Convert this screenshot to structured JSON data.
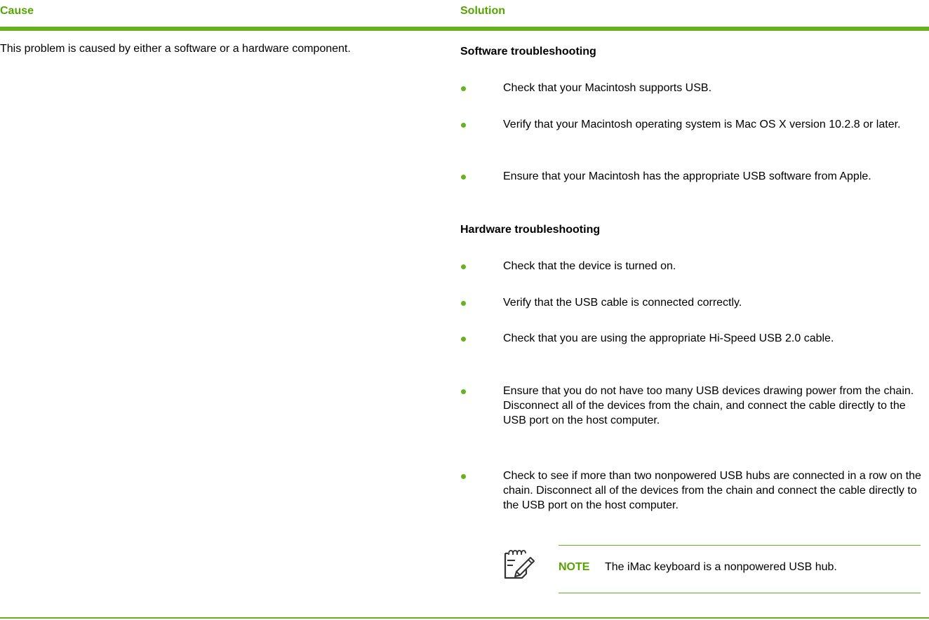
{
  "table": {
    "headers": {
      "cause": "Cause",
      "solution": "Solution"
    },
    "cause_text": "This problem is caused by either a software or a hardware component.",
    "software": {
      "heading": "Software troubleshooting",
      "items": [
        "Check that your Macintosh supports USB.",
        "Verify that your Macintosh operating system is Mac OS X version 10.2.8 or later.",
        "Ensure that your Macintosh has the appropriate USB software from Apple."
      ]
    },
    "hardware": {
      "heading": "Hardware troubleshooting",
      "items": [
        "Check that the device is turned on.",
        "Verify that the USB cable is connected correctly.",
        "Check that you are using the appropriate Hi-Speed USB 2.0 cable.",
        "Ensure that you do not have too many USB devices drawing power from the chain. Disconnect all of the devices from the chain, and connect the cable directly to the USB port on the host computer.",
        "Check to see if more than two nonpowered USB hubs are connected in a row on the chain. Disconnect all of the devices from the chain and connect the cable directly to the USB port on the host computer."
      ]
    },
    "note": {
      "label": "NOTE",
      "text": "The iMac keyboard is a nonpowered USB hub.",
      "icon": "note-pencil-icon"
    }
  },
  "colors": {
    "accent": "#66b21c",
    "heading_text": "#57a300"
  }
}
